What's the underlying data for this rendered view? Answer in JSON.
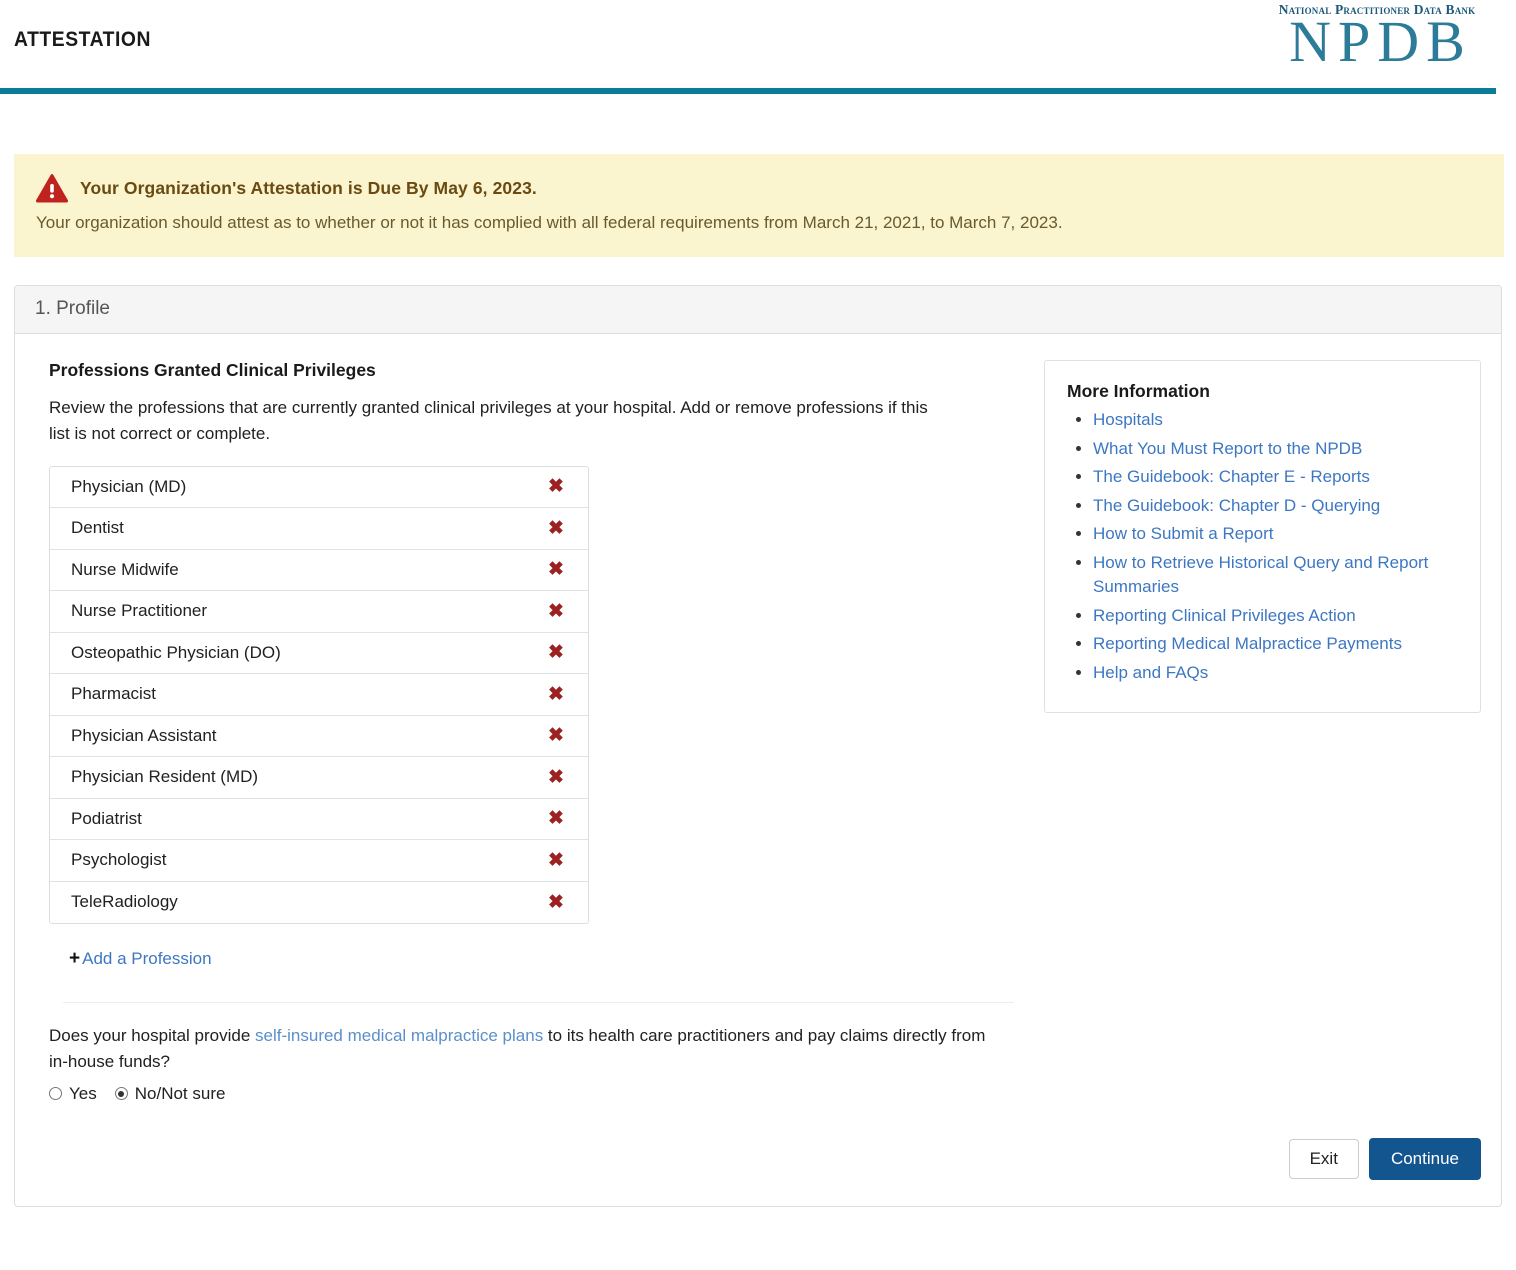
{
  "header": {
    "title": "ATTESTATION",
    "logo_tagline": "National Practitioner Data Bank",
    "logo_word": "NPDB",
    "rule_color": "#0b7d99",
    "logo_color": "#2b7b99"
  },
  "alert": {
    "icon": "warning-triangle-icon",
    "headline": "Your Organization's Attestation is Due By May 6, 2023.",
    "body": "Your organization should attest as to whether or not it has complied with all federal requirements from March 21, 2021, to March 7, 2023.",
    "background": "#faf4cf",
    "icon_color": "#c0231f"
  },
  "panel": {
    "step_title": "1. Profile"
  },
  "main": {
    "section_title": "Professions Granted Clinical Privileges",
    "section_desc": "Review the professions that are currently granted clinical privileges at your hospital. Add or remove professions if this list is not correct or complete.",
    "professions": [
      {
        "name": "Physician (MD)",
        "remove": "✖"
      },
      {
        "name": "Dentist",
        "remove": "✖"
      },
      {
        "name": "Nurse Midwife",
        "remove": "✖"
      },
      {
        "name": "Nurse Practitioner",
        "remove": "✖"
      },
      {
        "name": "Osteopathic Physician (DO)",
        "remove": "✖"
      },
      {
        "name": "Pharmacist",
        "remove": "✖"
      },
      {
        "name": "Physician Assistant",
        "remove": "✖"
      },
      {
        "name": "Physician Resident (MD)",
        "remove": "✖"
      },
      {
        "name": "Podiatrist",
        "remove": "✖"
      },
      {
        "name": "Psychologist",
        "remove": "✖"
      },
      {
        "name": "TeleRadiology",
        "remove": "✖"
      }
    ],
    "add_profession": {
      "plus": "+",
      "label": "Add a Profession"
    },
    "question": {
      "text_before": "Does your hospital provide ",
      "link": "self-insured medical malpractice plans",
      "text_after": " to its health care practitioners and pay claims directly from in-house funds?",
      "options": [
        {
          "label": "Yes",
          "selected": false
        },
        {
          "label": "No/Not sure",
          "selected": true
        }
      ]
    }
  },
  "aside": {
    "title": "More Information",
    "links": [
      "Hospitals",
      "What You Must Report to the NPDB",
      "The Guidebook: Chapter E - Reports",
      "The Guidebook: Chapter D - Querying",
      "How to Submit a Report",
      "How to Retrieve Historical Query and Report Summaries",
      "Reporting Clinical Privileges Action",
      "Reporting Medical Malpractice Payments",
      "Help and FAQs"
    ]
  },
  "footer": {
    "exit_label": "Exit",
    "continue_label": "Continue",
    "continue_color": "#12558f"
  }
}
